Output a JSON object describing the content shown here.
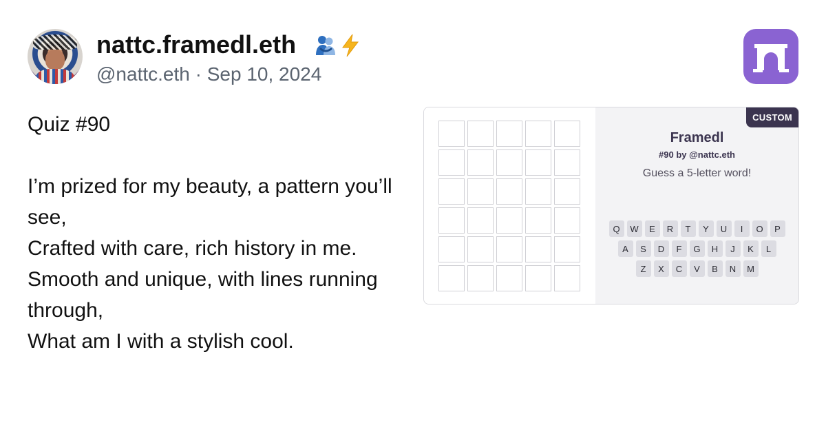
{
  "author": {
    "display_name": "nattc.framedl.eth",
    "badge_icons": [
      "people-hugging-icon",
      "lightning-icon"
    ],
    "handle": "@nattc.eth",
    "separator": "·",
    "date": "Sep 10, 2024"
  },
  "post": {
    "lines": [
      "Quiz #90",
      "",
      "I’m prized for my beauty, a pattern you’ll see,",
      "Crafted with care, rich history in me.",
      "Smooth and unique, with lines running through,",
      "What am I with a stylish cool."
    ]
  },
  "frame": {
    "badge": "CUSTOM",
    "title": "Framedl",
    "subtitle": "#90 by @nattc.eth",
    "prompt": "Guess a 5-letter word!",
    "grid_rows": 6,
    "grid_cols": 5,
    "keyboard_rows": [
      [
        "Q",
        "W",
        "E",
        "R",
        "T",
        "Y",
        "U",
        "I",
        "O",
        "P"
      ],
      [
        "A",
        "S",
        "D",
        "F",
        "G",
        "H",
        "J",
        "K",
        "L"
      ],
      [
        "Z",
        "X",
        "C",
        "V",
        "B",
        "N",
        "M"
      ]
    ]
  },
  "colors": {
    "brand_logo": "#8a63d2",
    "badge_bg": "#3b344f",
    "handle_text": "#5b6470"
  }
}
